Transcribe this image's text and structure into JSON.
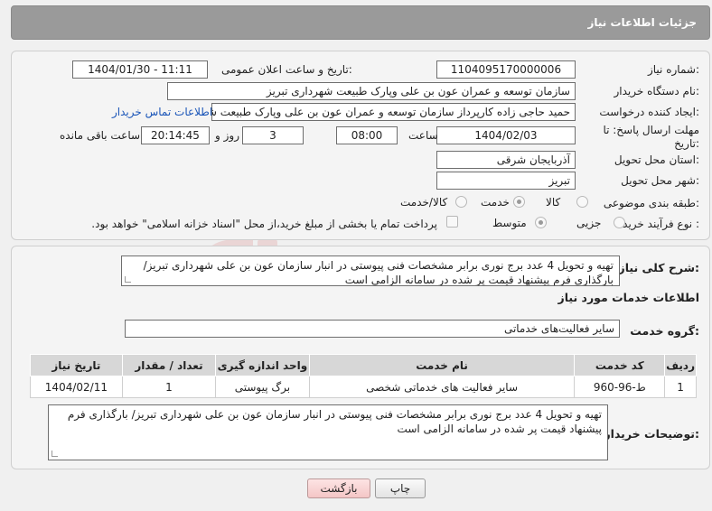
{
  "header": {
    "title": "جزئیات اطلاعات نیاز"
  },
  "fields": {
    "need_number_label": "شماره نیاز:",
    "need_number": "1104095170000006",
    "announce_label": "تاریخ و ساعت اعلان عمومی:",
    "announce_value": "1404/01/30 - 11:11",
    "buyer_org_label": "نام دستگاه خریدار:",
    "buyer_org": "سازمان توسعه و عمران عون بن علی وپارک طبیعت شهرداری تبریز",
    "requester_label": "ایجاد کننده درخواست:",
    "requester": "حمید حاجی زاده کارپرداز سازمان توسعه و عمران عون بن علی وپارک طبیعت شه",
    "contact_link": "اطلاعات تماس خریدار",
    "deadline_label": "مهلت ارسال پاسخ: تا تاریخ:",
    "deadline_date": "1404/02/03",
    "time_label": "ساعت",
    "deadline_time": "08:00",
    "days_value": "3",
    "days_label": "روز و",
    "remaining_time": "20:14:45",
    "remaining_label": "ساعت باقی مانده",
    "province_label": "استان محل تحویل:",
    "province": "آذربایجان شرقی",
    "city_label": "شهر محل تحویل:",
    "city": "تبریز",
    "category_label": "طبقه بندی موضوعی:",
    "category_options": [
      "کالا",
      "خدمت",
      "کالا/خدمت"
    ],
    "process_label": "نوع فرآیند خرید :",
    "process_options": [
      "جزیی",
      "متوسط"
    ],
    "payment_note": "پرداخت تمام یا بخشی از مبلغ خرید،از محل \"اسناد خزانه اسلامی\" خواهد بود."
  },
  "summary": {
    "label": "شرح کلی نیاز:",
    "text": "تهیه و تحویل 4 عدد برج نوری برابر مشخصات فنی پیوستی در انبار سازمان عون بن علی شهرداری تبریز/ بارگذاری فرم پیشنهاد قیمت پر شده در سامانه الزامی است"
  },
  "services": {
    "section_title": "اطلاعات خدمات مورد نیاز",
    "group_label": "گروه خدمت:",
    "group_value": "سایر فعالیت‌های خدماتی",
    "columns": [
      "ردیف",
      "کد خدمت",
      "نام خدمت",
      "واحد اندازه گیری",
      "تعداد / مقدار",
      "تاریخ نیاز"
    ],
    "rows": [
      [
        "1",
        "ط-96-960",
        "سایر فعالیت های خدماتی شخصی",
        "برگ پیوستی",
        "1",
        "1404/02/11"
      ]
    ]
  },
  "buyer_notes": {
    "label": "توضیحات خریدار:",
    "text": "تهیه و تحویل 4 عدد برج نوری برابر مشخصات فنی پیوستی در انبار سازمان عون بن علی شهرداری تبریز/ بارگذاری فرم پیشنهاد قیمت پر شده در سامانه الزامی است"
  },
  "buttons": {
    "print": "چاپ",
    "back": "بازگشت"
  },
  "watermark": {
    "text": "AriaTender.neT"
  },
  "colors": {
    "header_bg": "#9a9a9a",
    "link": "#1a55b8",
    "watermark": "#d97a7a"
  }
}
